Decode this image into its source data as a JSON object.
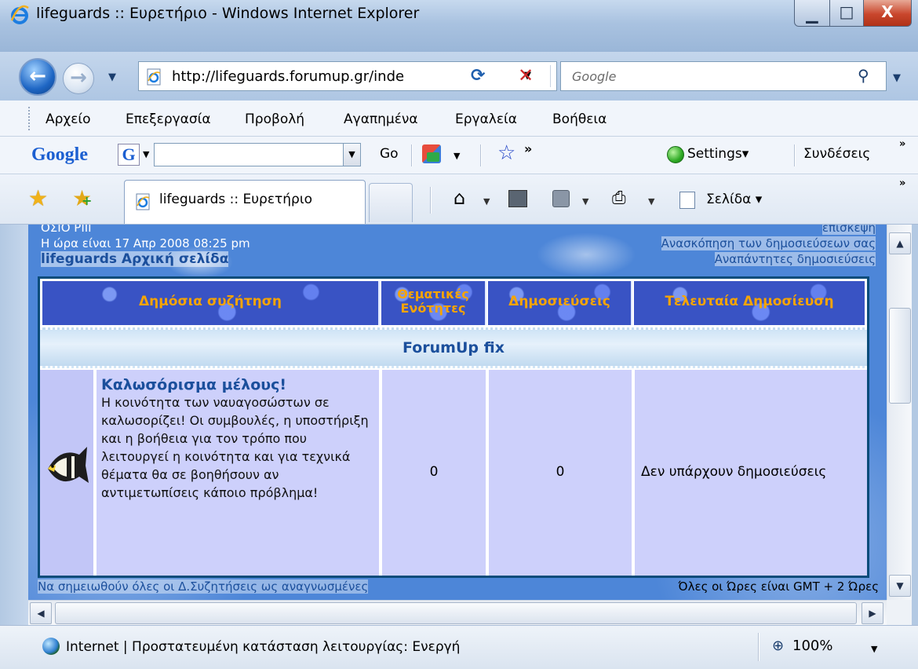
{
  "window": {
    "title": "lifeguards :: Ευρετήριο - Windows Internet Explorer",
    "min_glyph": "▁",
    "max_glyph": "□",
    "close_glyph": "X"
  },
  "nav": {
    "back_glyph": "←",
    "forward_glyph": "→",
    "url": "http://lifeguards.forumup.gr/inde",
    "search_placeholder": "Google"
  },
  "menu": {
    "items": [
      "Αρχείο",
      "Επεξεργασία",
      "Προβολή",
      "Αγαπημένα",
      "Εργαλεία",
      "Βοήθεια"
    ]
  },
  "google_toolbar": {
    "logo": "Google",
    "badge": "G",
    "go_label": "Go",
    "settings_label": "Settings",
    "links_label": "Συνδέσεις"
  },
  "tabs": {
    "active_label": "lifeguards :: Ευρετήριο"
  },
  "command_bar": {
    "page_label": "Σελίδα"
  },
  "page": {
    "top_left_partial": "ΟΣΙΟ ΡΙΙΙ",
    "current_time": "Η ώρα είναι 17 Απρ 2008 08:25 pm",
    "home_link": "lifeguards Αρχική σελίδα",
    "top_right_partial": "επισκεψη",
    "view_posts_link": "Ανασκόπηση των δημοσιεύσεων σας",
    "unanswered_link": "Αναπάντητες δημοσιεύσεις",
    "table": {
      "headers": [
        "Δημόσια συζήτηση",
        "Θεματικές Ενότητες",
        "Δημοσιεύσεις",
        "Τελευταία Δημοσίευση"
      ],
      "category": "ForumUp fix",
      "forum": {
        "title": "Καλωσόρισμα μέλους!",
        "description": "Η κοινότητα των ναυαγοσώστων σε καλωσορίζει! Οι συμβουλές, η υποστήριξη και η βοήθεια για τον τρόπο που λειτουργεί η κοινότητα και για τεχνικά θέματα θα σε βοηθήσουν αν αντιμετωπίσεις κάποιο πρόβλημα!",
        "topics": "0",
        "posts": "0",
        "last_post": "Δεν υπάρχουν δημοσιεύσεις"
      }
    },
    "mark_read_link": "Να σημειωθούν όλες οι Δ.Συζητήσεις ως αναγνωσμένες",
    "timezone": "Όλες οι Ώρες είναι GMT + 2 Ώρες"
  },
  "status": {
    "zone_text": "Internet | Προστατευμένη κατάσταση λειτουργίας: Ενεργή",
    "zoom": "100%"
  }
}
